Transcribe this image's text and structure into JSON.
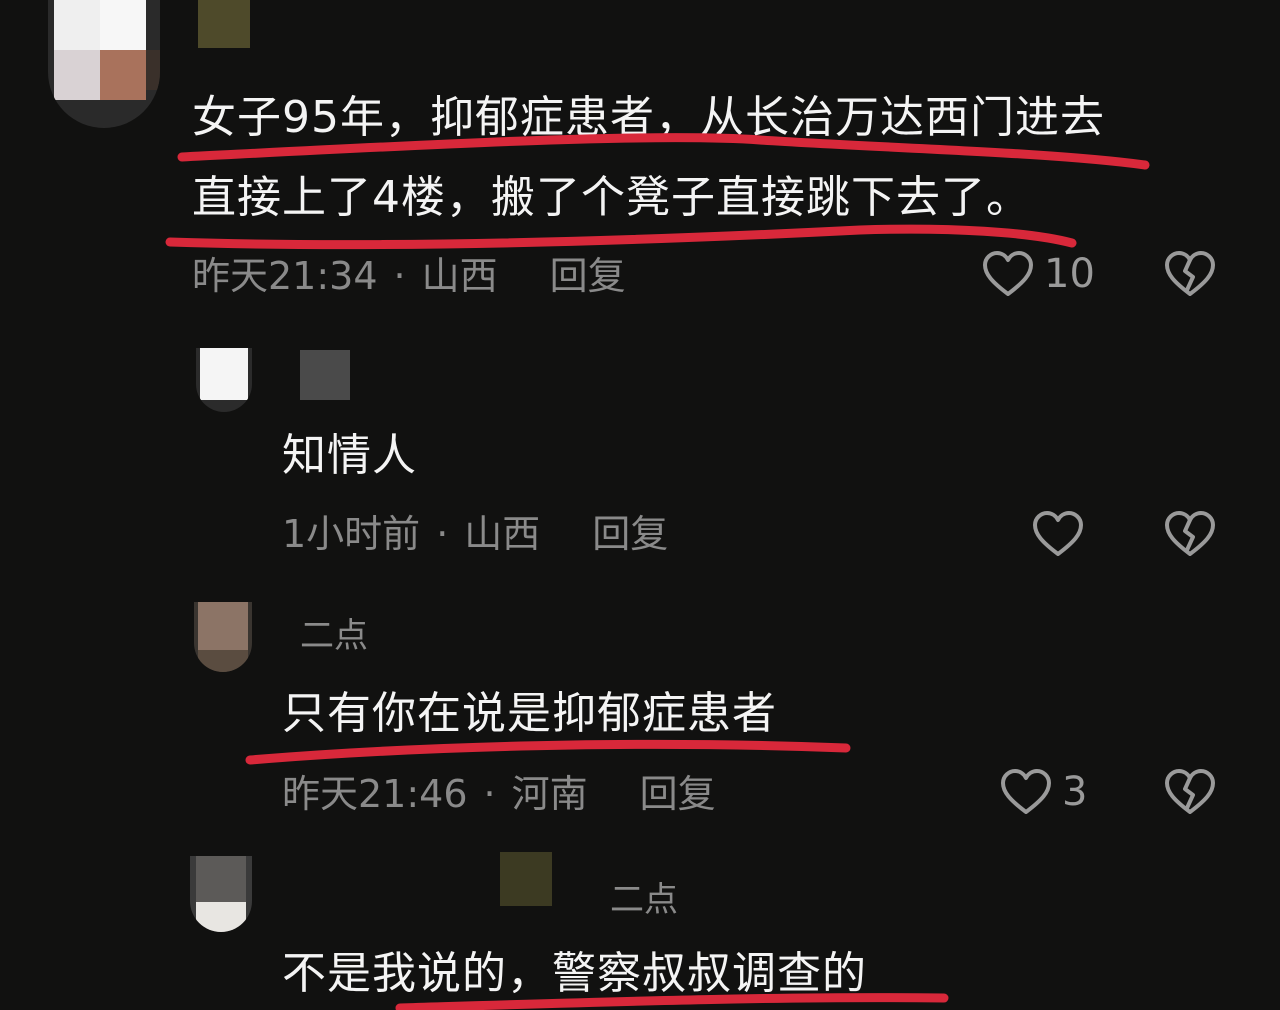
{
  "comments": [
    {
      "text_line1": "女子95年，抑郁症患者，从长治万达西门进去",
      "text_line2": "直接上了4楼，搬了个凳子直接跳下去了。",
      "time": "昨天21:34",
      "location": "山西",
      "reply_label": "回复",
      "likes": "10"
    },
    {
      "text": "知情人",
      "time": "1小时前",
      "location": "山西",
      "reply_label": "回复",
      "likes": ""
    },
    {
      "username": "二点",
      "text": "只有你在说是抑郁症患者",
      "time": "昨天21:46",
      "location": "河南",
      "reply_label": "回复",
      "likes": "3"
    },
    {
      "username": "二点",
      "text": "不是我说的，警察叔叔调查的"
    }
  ],
  "separator": "·",
  "icons": {
    "like": "heart-outline-icon",
    "dislike": "broken-heart-icon"
  },
  "colors": {
    "background": "#111110",
    "underline": "#d8283a",
    "meta": "#8a8a8a"
  }
}
